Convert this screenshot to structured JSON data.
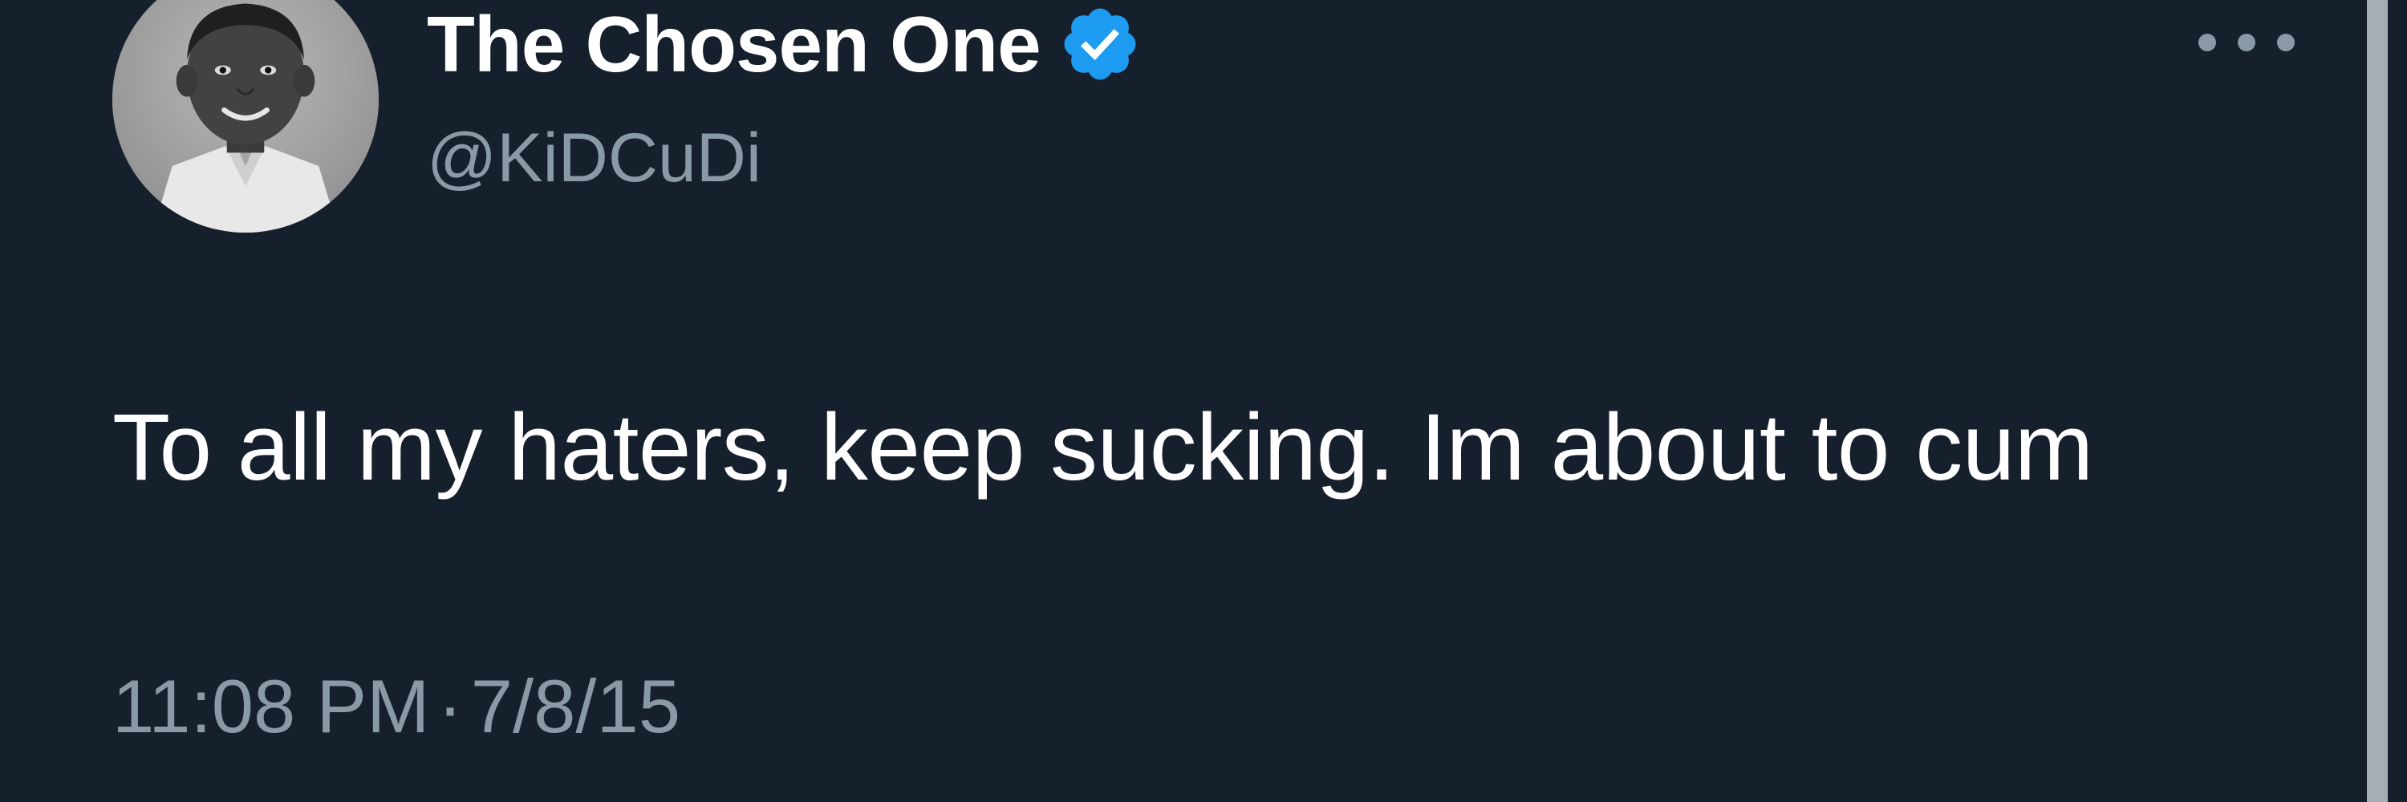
{
  "tweet": {
    "display_name": "The Chosen One",
    "handle": "@KiDCuDi",
    "text": "To all my haters, keep sucking. Im about to cum",
    "time": "11:08 PM",
    "separator": "·",
    "date": "7/8/15",
    "verified": true,
    "verified_color": "#1d9bf0"
  },
  "icons": {
    "avatar": "avatar-photo",
    "verified": "verified-badge-icon",
    "more": "more-options-icon"
  },
  "colors": {
    "background": "#16202d",
    "primary_text": "#ffffff",
    "secondary_text": "#8b98a5"
  }
}
